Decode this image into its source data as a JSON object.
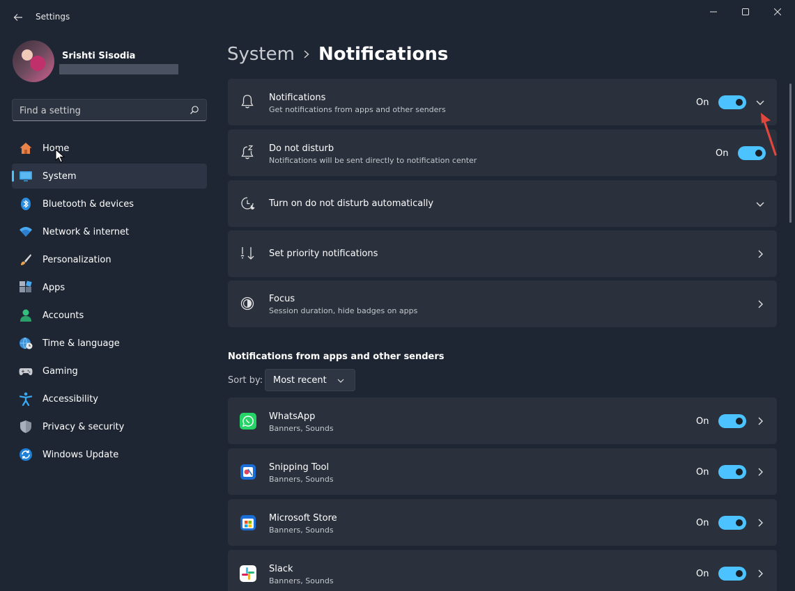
{
  "window": {
    "title": "Settings"
  },
  "profile": {
    "name": "Srishti Sisodia"
  },
  "search": {
    "placeholder": "Find a setting"
  },
  "nav": {
    "items": [
      {
        "label": "Home"
      },
      {
        "label": "System"
      },
      {
        "label": "Bluetooth & devices"
      },
      {
        "label": "Network & internet"
      },
      {
        "label": "Personalization"
      },
      {
        "label": "Apps"
      },
      {
        "label": "Accounts"
      },
      {
        "label": "Time & language"
      },
      {
        "label": "Gaming"
      },
      {
        "label": "Accessibility"
      },
      {
        "label": "Privacy & security"
      },
      {
        "label": "Windows Update"
      }
    ]
  },
  "breadcrumb": {
    "parent": "System",
    "current": "Notifications"
  },
  "settings": {
    "notifications": {
      "title": "Notifications",
      "subtitle": "Get notifications from apps and other senders",
      "state": "On"
    },
    "dnd": {
      "title": "Do not disturb",
      "subtitle": "Notifications will be sent directly to notification center",
      "state": "On"
    },
    "dnd_auto": {
      "title": "Turn on do not disturb automatically"
    },
    "priority": {
      "title": "Set priority notifications"
    },
    "focus": {
      "title": "Focus",
      "subtitle": "Session duration, hide badges on apps"
    }
  },
  "apps_section": {
    "title": "Notifications from apps and other senders",
    "sort_label": "Sort by:",
    "sort_value": "Most recent",
    "apps": [
      {
        "name": "WhatsApp",
        "detail": "Banners, Sounds",
        "state": "On"
      },
      {
        "name": "Snipping Tool",
        "detail": "Banners, Sounds",
        "state": "On"
      },
      {
        "name": "Microsoft Store",
        "detail": "Banners, Sounds",
        "state": "On"
      },
      {
        "name": "Slack",
        "detail": "Banners, Sounds",
        "state": "On"
      }
    ]
  },
  "colors": {
    "accent": "#4cc2ff",
    "background": "#1f2633",
    "card": "#2a303c",
    "annotation_arrow": "#e0463c"
  }
}
